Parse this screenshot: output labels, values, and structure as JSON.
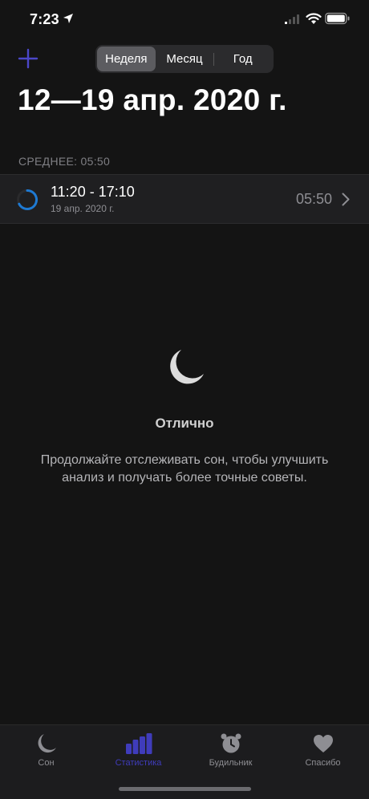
{
  "status_bar": {
    "time": "7:23"
  },
  "nav": {
    "add_icon": "plus-icon",
    "segments": [
      {
        "label": "Неделя",
        "selected": true
      },
      {
        "label": "Месяц",
        "selected": false
      },
      {
        "label": "Год",
        "selected": false
      }
    ]
  },
  "title": "12—19 апр. 2020 г.",
  "average_label": "СРЕДНЕЕ: 05:50",
  "session": {
    "time_range": "11:20 - 17:10",
    "date": "19 апр. 2020 г.",
    "duration": "05:50",
    "ring_color": "#1e7ad3"
  },
  "empty_state": {
    "icon": "moon-icon",
    "title": "Отлично",
    "description": "Продолжайте отслеживать сон, чтобы улучшить анализ и получать более точные советы."
  },
  "tab_bar": {
    "tabs": [
      {
        "label": "Сон",
        "icon": "moon-icon",
        "active": false
      },
      {
        "label": "Статистика",
        "icon": "bar-chart-icon",
        "active": true
      },
      {
        "label": "Будильник",
        "icon": "alarm-clock-icon",
        "active": false
      },
      {
        "label": "Спасибо",
        "icon": "heart-icon",
        "active": false
      }
    ]
  },
  "colors": {
    "accent": "#3f3cbb",
    "background": "#141414",
    "row": "#1f1f21"
  }
}
